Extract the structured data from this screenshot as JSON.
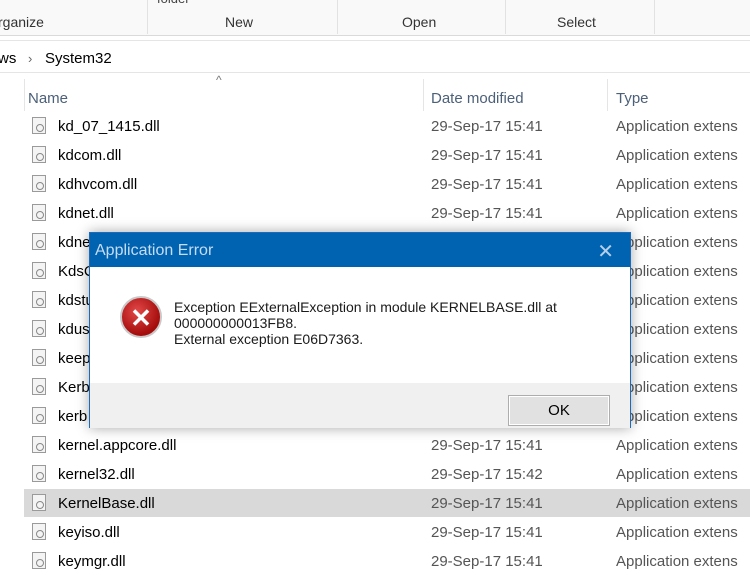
{
  "ribbon": {
    "folder_fragment": "folder",
    "groups": [
      "rganize",
      "New",
      "Open",
      "Select"
    ]
  },
  "address": {
    "parent": "ws",
    "separator": "›",
    "current": "System32"
  },
  "columns": {
    "name": "Name",
    "date": "Date modified",
    "type": "Type",
    "sort_indicator": "^"
  },
  "rows": [
    {
      "name": "kd_07_1415.dll",
      "date": "29-Sep-17 15:41",
      "type": "Application extens"
    },
    {
      "name": "kdcom.dll",
      "date": "29-Sep-17 15:41",
      "type": "Application extens"
    },
    {
      "name": "kdhvcom.dll",
      "date": "29-Sep-17 15:41",
      "type": "Application extens"
    },
    {
      "name": "kdnet.dll",
      "date": "29-Sep-17 15:41",
      "type": "Application extens"
    },
    {
      "name": "kdne",
      "date": "",
      "type": "Application extens"
    },
    {
      "name": "KdsC",
      "date": "",
      "type": "Application extens"
    },
    {
      "name": "kdstu",
      "date": "",
      "type": "Application extens"
    },
    {
      "name": "kdus",
      "date": "",
      "type": "Application extens"
    },
    {
      "name": "keep",
      "date": "",
      "type": "Application extens"
    },
    {
      "name": "Kerb",
      "date": "",
      "type": "Application extens"
    },
    {
      "name": "kerb",
      "date": "",
      "type": "Application extens"
    },
    {
      "name": "kernel.appcore.dll",
      "date": "29-Sep-17 15:41",
      "type": "Application extens"
    },
    {
      "name": "kernel32.dll",
      "date": "29-Sep-17 15:42",
      "type": "Application extens"
    },
    {
      "name": "KernelBase.dll",
      "date": "29-Sep-17 15:41",
      "type": "Application extens",
      "selected": true
    },
    {
      "name": "keyiso.dll",
      "date": "29-Sep-17 15:41",
      "type": "Application extens"
    },
    {
      "name": "keymgr.dll",
      "date": "29-Sep-17 15:41",
      "type": "Application extens"
    }
  ],
  "dialog": {
    "title": "Application Error",
    "close": "✕",
    "icon": "error-icon",
    "icon_glyph": "✕",
    "message_lines": [
      "Exception EExternalException in module KERNELBASE.dll at",
      "000000000013FB8.",
      "External exception E06D7363."
    ],
    "ok_label": "OK"
  }
}
